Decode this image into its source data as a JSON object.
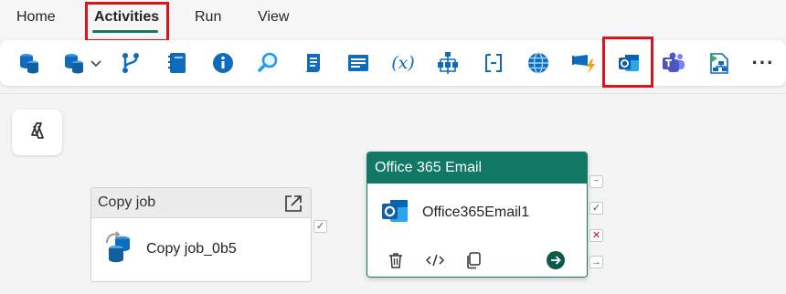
{
  "menu": {
    "tabs": [
      {
        "label": "Home"
      },
      {
        "label": "Activities"
      },
      {
        "label": "Run"
      },
      {
        "label": "View"
      }
    ],
    "active_tab": "Activities"
  },
  "toolbar": {
    "more_label": "···",
    "icons": [
      "copy-data-icon",
      "copy-data-dropdown-icon",
      "dataflow-icon",
      "notebook-icon",
      "info-icon",
      "lookup-icon",
      "script-icon",
      "list-icon",
      "variable-icon",
      "switch-icon",
      "if-condition-icon",
      "web-icon",
      "azure-function-icon",
      "outlook-icon",
      "teams-icon",
      "pipeline-icon",
      "more-icon"
    ],
    "variable_glyph": "(x)"
  },
  "canvas": {
    "copy_job_card": {
      "header": "Copy job",
      "name": "Copy job_0b5"
    },
    "office_card": {
      "header": "Office 365 Email",
      "name": "Office365Email1"
    }
  },
  "colors": {
    "accent": "#117865",
    "highlight": "#d9141c",
    "blue": "#0f6cbd"
  }
}
